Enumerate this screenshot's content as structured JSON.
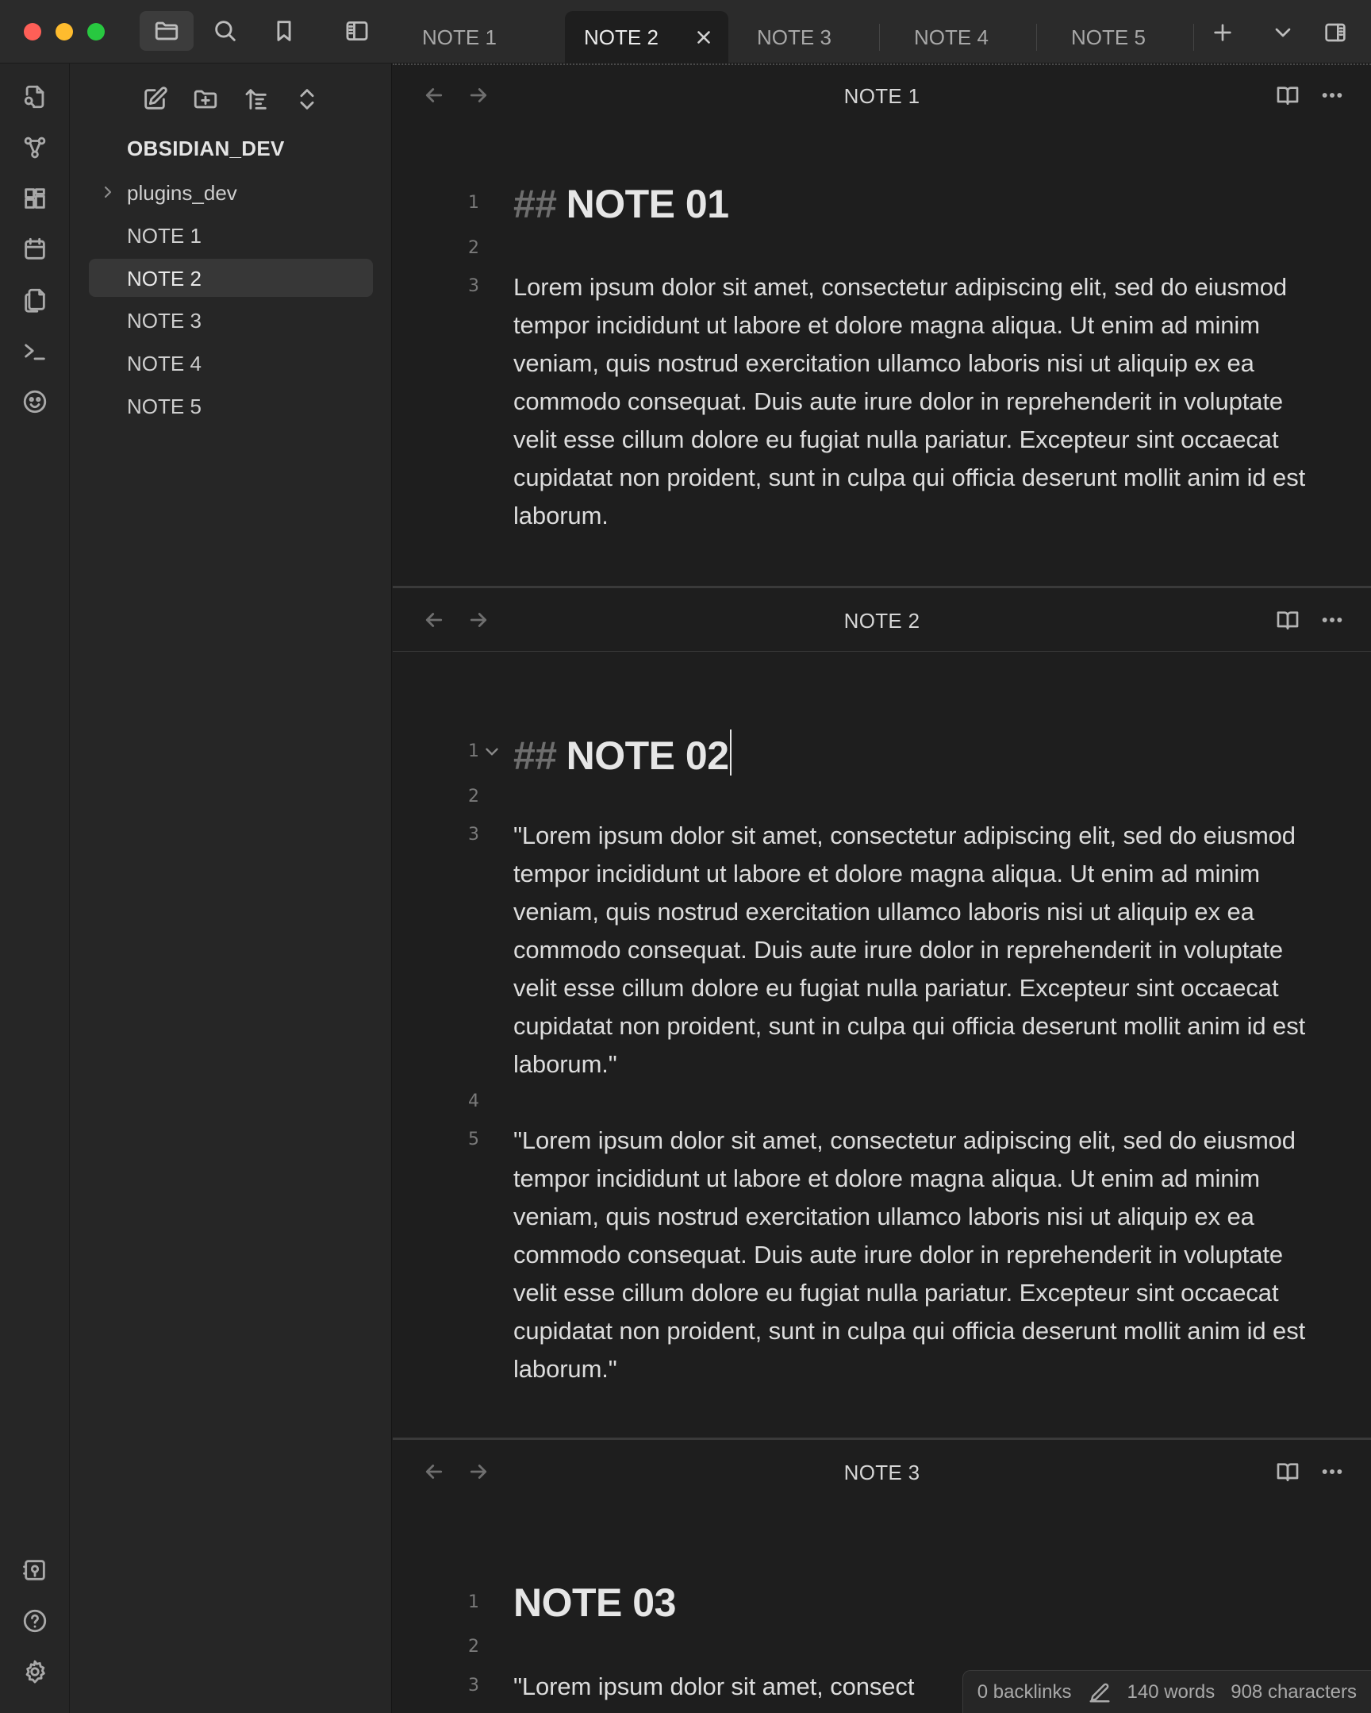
{
  "window": {
    "tabs": [
      {
        "label": "NOTE 1",
        "active": false
      },
      {
        "label": "NOTE 2",
        "active": true
      },
      {
        "label": "NOTE 3",
        "active": false
      },
      {
        "label": "NOTE 4",
        "active": false
      },
      {
        "label": "NOTE 5",
        "active": false
      }
    ]
  },
  "icons": {
    "titlebar": [
      "folder-icon",
      "search-icon",
      "bookmark-icon",
      "sidebar-toggle-icon"
    ],
    "titlebar_right": [
      "plus-icon",
      "chevron-down-icon",
      "right-sidebar-icon"
    ],
    "ribbon_top": [
      "quick-switcher-icon",
      "graph-icon",
      "canvas-icon",
      "calendar-icon",
      "templates-icon",
      "terminal-icon",
      "face-icon"
    ],
    "ribbon_bottom": [
      "vault-icon",
      "help-icon",
      "settings-icon"
    ],
    "sidebar_tools": [
      "new-note-icon",
      "new-folder-icon",
      "sort-icon",
      "collapse-icon"
    ]
  },
  "sidebar": {
    "vault_name": "OBSIDIAN_DEV",
    "items": [
      {
        "label": "plugins_dev",
        "type": "folder",
        "active": false
      },
      {
        "label": "NOTE 1",
        "type": "file",
        "active": false
      },
      {
        "label": "NOTE 2",
        "type": "file",
        "active": true
      },
      {
        "label": "NOTE 3",
        "type": "file",
        "active": false
      },
      {
        "label": "NOTE 4",
        "type": "file",
        "active": false
      },
      {
        "label": "NOTE 5",
        "type": "file",
        "active": false
      }
    ]
  },
  "panes": [
    {
      "title": "NOTE 1",
      "lines": [
        {
          "no": "1",
          "hash": "##",
          "text": "NOTE 01"
        },
        {
          "no": "2",
          "text": ""
        },
        {
          "no": "3",
          "text": "Lorem ipsum dolor sit amet, consectetur adipiscing elit, sed do eiusmod tempor incididunt ut labore et dolore magna aliqua. Ut enim ad minim veniam, quis nostrud exercitation ullamco laboris nisi ut aliquip ex ea commodo consequat. Duis aute irure dolor in reprehenderit in voluptate velit esse cillum dolore eu fugiat nulla pariatur. Excepteur sint occaecat cupidatat non proident, sunt in culpa qui officia deserunt mollit anim id est laborum."
        }
      ]
    },
    {
      "title": "NOTE 2",
      "lines": [
        {
          "no": "1",
          "hash": "##",
          "text": "NOTE 02"
        },
        {
          "no": "2",
          "text": ""
        },
        {
          "no": "3",
          "text": "\"Lorem ipsum dolor sit amet, consectetur adipiscing elit, sed do eiusmod tempor incididunt ut labore et dolore magna aliqua. Ut enim ad minim veniam, quis nostrud exercitation ullamco laboris nisi ut aliquip ex ea commodo consequat. Duis aute irure dolor in reprehenderit in voluptate velit esse cillum dolore eu fugiat nulla pariatur. Excepteur sint occaecat cupidatat non proident, sunt in culpa qui officia deserunt mollit anim id est laborum.\""
        },
        {
          "no": "4",
          "text": ""
        },
        {
          "no": "5",
          "text": "\"Lorem ipsum dolor sit amet, consectetur adipiscing elit, sed do eiusmod tempor incididunt ut labore et dolore magna aliqua. Ut enim ad minim veniam, quis nostrud exercitation ullamco laboris nisi ut aliquip ex ea commodo consequat. Duis aute irure dolor in reprehenderit in voluptate velit esse cillum dolore eu fugiat nulla pariatur. Excepteur sint occaecat cupidatat non proident, sunt in culpa qui officia deserunt mollit anim id est laborum.\""
        }
      ]
    },
    {
      "title": "NOTE 3",
      "lines": [
        {
          "no": "1",
          "text": "NOTE 03"
        },
        {
          "no": "2",
          "text": ""
        },
        {
          "no": "3",
          "text": "\"Lorem ipsum dolor sit amet, consect"
        }
      ]
    }
  ],
  "statusbar": {
    "backlinks": "0 backlinks",
    "words": "140 words",
    "characters": "908 characters"
  }
}
